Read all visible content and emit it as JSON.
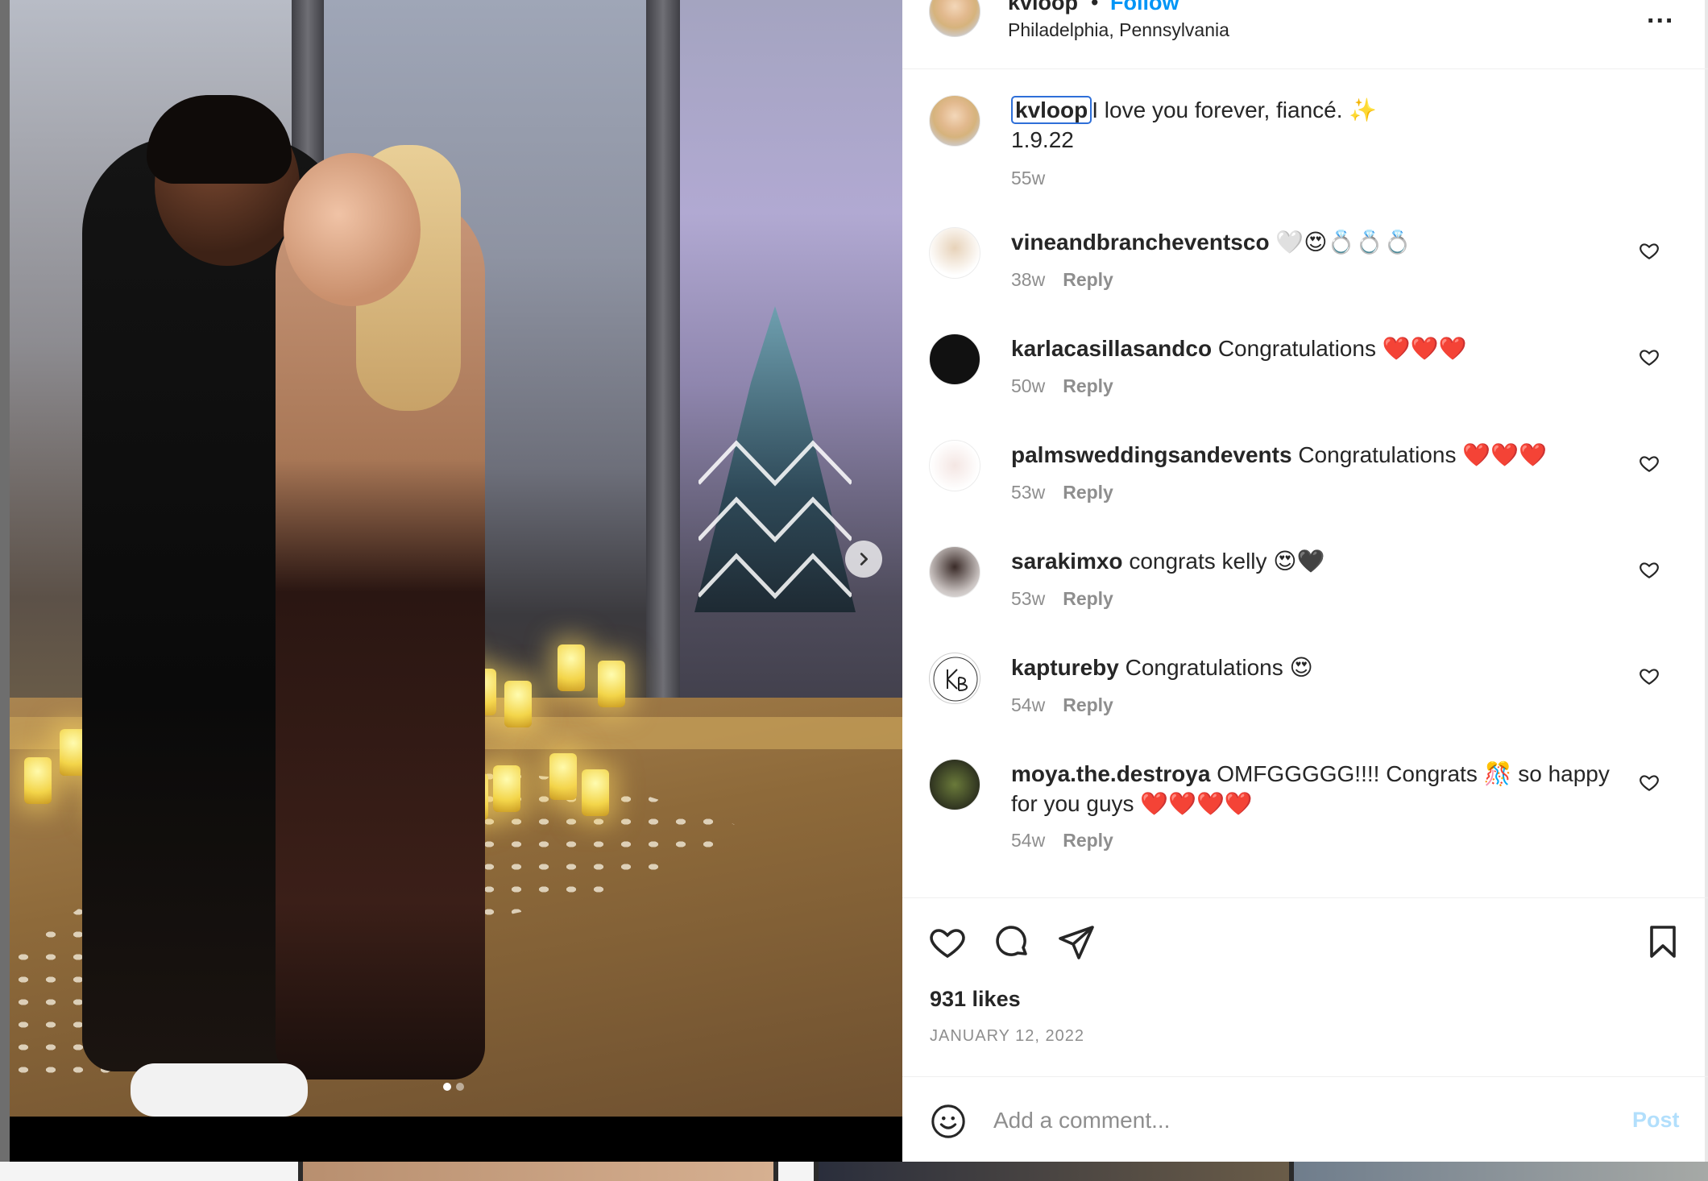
{
  "colors": {
    "accent": "#0095f6",
    "highlight_box": "#2e6fd8",
    "muted": "#8e8e8e",
    "text": "#262626"
  },
  "header": {
    "username": "kvloop",
    "separator": "•",
    "follow_label": "Follow",
    "location": "Philadelphia, Pennsylvania",
    "more_label": "..."
  },
  "caption": {
    "username": "kvloop",
    "text": "I love you forever, fiancé. ✨",
    "line2": "1.9.22",
    "time": "55w"
  },
  "comments": [
    {
      "user": "vineandbrancheventsco",
      "text": "🤍😍💍💍💍",
      "time": "38w",
      "reply": "Reply"
    },
    {
      "user": "karlacasillasandco",
      "text": "Congratulations ❤️❤️❤️",
      "time": "50w",
      "reply": "Reply"
    },
    {
      "user": "palmsweddingsandevents",
      "text": "Congratulations ❤️❤️❤️",
      "time": "53w",
      "reply": "Reply"
    },
    {
      "user": "sarakimxo",
      "text": "congrats kelly 😍🖤",
      "time": "53w",
      "reply": "Reply"
    },
    {
      "user": "kaptureby",
      "text": "Congratulations 😍",
      "time": "54w",
      "reply": "Reply"
    },
    {
      "user": "moya.the.destroya",
      "text": "OMFGGGGG!!!! Congrats 🎊 so happy for you guys ❤️❤️❤️❤️",
      "time": "54w",
      "reply": "Reply"
    }
  ],
  "icons": {
    "like": "heart-icon",
    "comment": "comment-icon",
    "share": "share-icon",
    "save": "bookmark-icon",
    "emoji": "emoji-icon",
    "next": "chevron-right-icon",
    "more": "more-icon"
  },
  "post": {
    "likes": "931 likes",
    "date": "JANUARY 12, 2022",
    "carousel_slide": 1,
    "carousel_total": 2
  },
  "composer": {
    "placeholder": "Add a comment...",
    "post_label": "Post"
  }
}
